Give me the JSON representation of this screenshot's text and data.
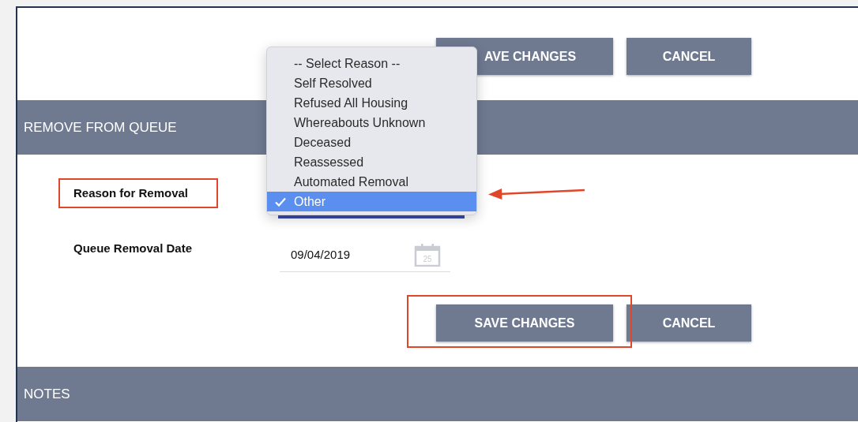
{
  "top_actions": {
    "save_label": "AVE CHANGES",
    "cancel_label": "CANCEL"
  },
  "section": {
    "title": "REMOVE FROM QUEUE"
  },
  "fields": [
    {
      "label": "Reason for Removal",
      "kind": "select",
      "highlighted": true
    },
    {
      "label": "Queue Removal Date",
      "kind": "date",
      "value": "09/04/2019",
      "icon_text": "25",
      "highlighted": false
    }
  ],
  "dropdown": {
    "options": [
      {
        "label": "-- Select Reason --",
        "selected": false
      },
      {
        "label": "Self Resolved",
        "selected": false
      },
      {
        "label": "Refused All Housing",
        "selected": false
      },
      {
        "label": "Whereabouts Unknown",
        "selected": false
      },
      {
        "label": "Deceased",
        "selected": false
      },
      {
        "label": "Reassessed",
        "selected": false
      },
      {
        "label": "Automated Removal",
        "selected": false
      },
      {
        "label": "Other",
        "selected": true
      }
    ]
  },
  "bottom_actions": {
    "save_label": "SAVE CHANGES",
    "cancel_label": "CANCEL",
    "save_highlighted": true
  },
  "notes": {
    "title": "NOTES"
  }
}
